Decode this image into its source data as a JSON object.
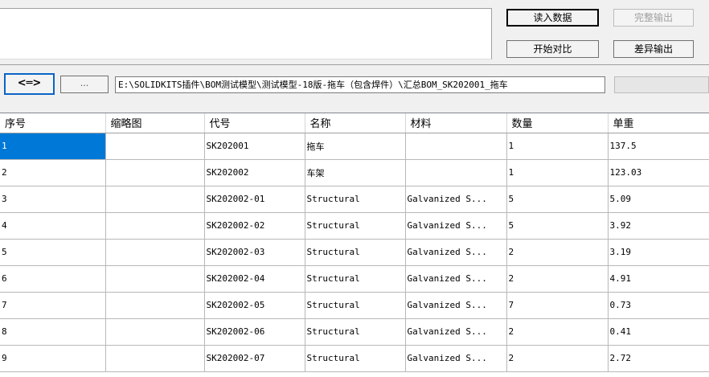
{
  "toolbar": {
    "load_data": "读入数据",
    "full_export": "完整输出",
    "start_compare": "开始对比",
    "diff_export": "差异输出"
  },
  "nav": {
    "swap_label": "<═>",
    "browse_label": "...",
    "path_value": "E:\\SOLIDKITS插件\\BOM测试模型\\测试模型-18版-拖车（包含焊件）\\汇总BOM_SK202001_拖车"
  },
  "table": {
    "columns": [
      "序号",
      "缩略图",
      "代号",
      "名称",
      "材料",
      "数量",
      "单重"
    ],
    "rows": [
      [
        "1",
        "",
        "SK202001",
        "拖车",
        "",
        "1",
        "137.5"
      ],
      [
        "2",
        "",
        "SK202002",
        "车架",
        "",
        "1",
        "123.03"
      ],
      [
        "3",
        "",
        "SK202002-01",
        "Structural",
        "Galvanized S...",
        "5",
        "5.09"
      ],
      [
        "4",
        "",
        "SK202002-02",
        "Structural",
        "Galvanized S...",
        "5",
        "3.92"
      ],
      [
        "5",
        "",
        "SK202002-03",
        "Structural",
        "Galvanized S...",
        "2",
        "3.19"
      ],
      [
        "6",
        "",
        "SK202002-04",
        "Structural",
        "Galvanized S...",
        "2",
        "4.91"
      ],
      [
        "7",
        "",
        "SK202002-05",
        "Structural",
        "Galvanized S...",
        "7",
        "0.73"
      ],
      [
        "8",
        "",
        "SK202002-06",
        "Structural",
        "Galvanized S...",
        "2",
        "0.41"
      ],
      [
        "9",
        "",
        "SK202002-07",
        "Structural",
        "Galvanized S...",
        "2",
        "2.72"
      ]
    ],
    "selected_row": 0
  },
  "colors": {
    "selection": "#0078d7",
    "focus_border": "#0a64c8"
  }
}
